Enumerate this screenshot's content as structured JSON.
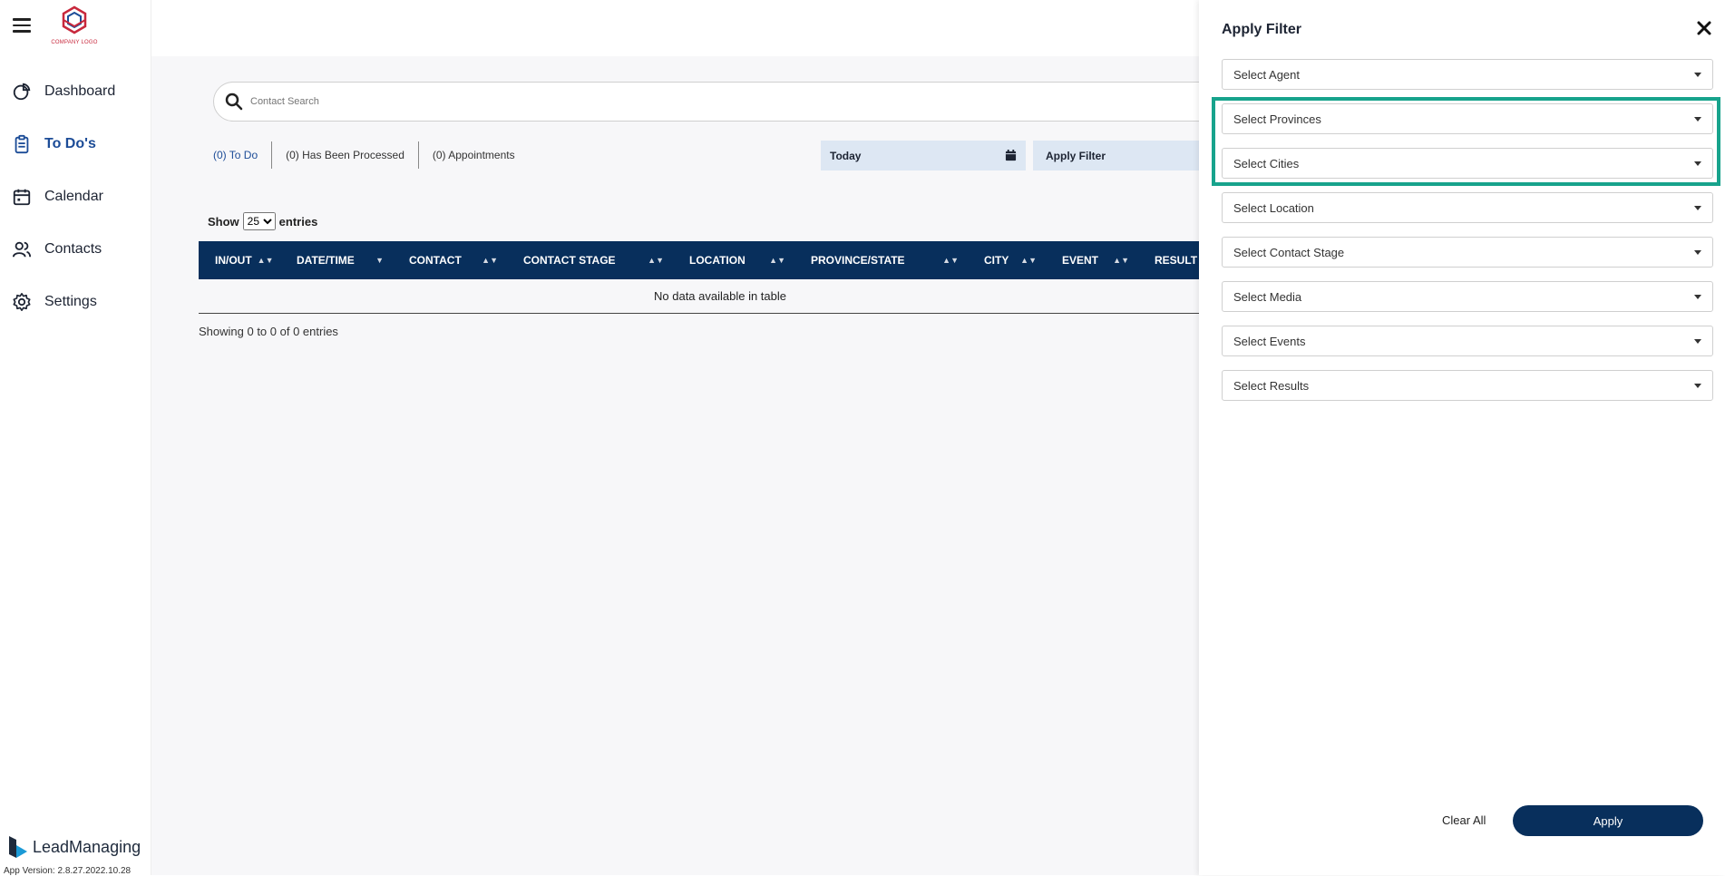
{
  "logo": {
    "text": "COMPANY LOGO"
  },
  "nav": {
    "items": [
      {
        "label": "Dashboard",
        "icon": "dashboard-icon"
      },
      {
        "label": "To Do's",
        "icon": "clipboard-icon",
        "active": true
      },
      {
        "label": "Calendar",
        "icon": "calendar-icon"
      },
      {
        "label": "Contacts",
        "icon": "contacts-icon"
      },
      {
        "label": "Settings",
        "icon": "gear-icon"
      }
    ]
  },
  "brand": {
    "name": "LeadManaging",
    "version": "App Version: 2.8.27.2022.10.28"
  },
  "search": {
    "placeholder": "Contact Search"
  },
  "tabs": [
    "(0) To Do",
    "(0) Has Been Processed",
    "(0) Appointments"
  ],
  "date_filter": {
    "label": "Today"
  },
  "apply_filter_button": {
    "label": "Apply Filter"
  },
  "entries": {
    "show": "Show",
    "value": "25",
    "suffix": "entries",
    "options": [
      "25"
    ]
  },
  "table": {
    "columns": [
      "IN/OUT",
      "DATE/TIME",
      "CONTACT",
      "CONTACT STAGE",
      "LOCATION",
      "PROVINCE/STATE",
      "CITY",
      "EVENT",
      "RESULT"
    ],
    "empty_text": "No data available in table",
    "footer": "Showing 0 to 0 of 0 entries"
  },
  "panel": {
    "title": "Apply Filter",
    "fields": [
      "Select Agent",
      "Select Provinces",
      "Select Cities",
      "Select Location",
      "Select Contact Stage",
      "Select Media",
      "Select Events",
      "Select Results"
    ],
    "clear_label": "Clear All",
    "apply_label": "Apply"
  },
  "colors": {
    "navy": "#082f5c",
    "accent_blue": "#1c4c97",
    "highlight": "#17a38c",
    "logo_red": "#c8283c"
  }
}
